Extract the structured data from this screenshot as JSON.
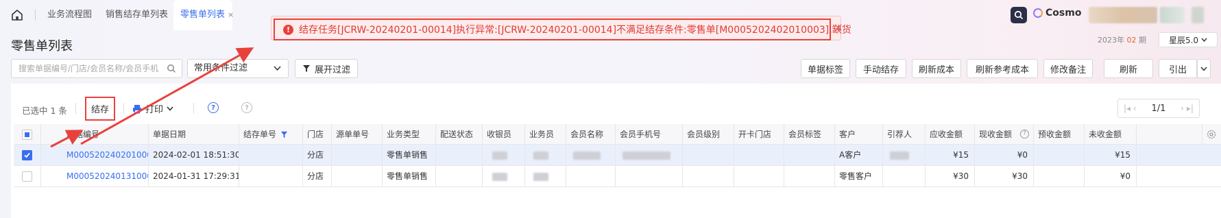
{
  "tabs": [
    {
      "label": "业务流程图"
    },
    {
      "label": "销售结存单列表"
    },
    {
      "label": "零售单列表",
      "close": "×"
    }
  ],
  "header": {
    "brand": "Cosmo"
  },
  "toast": {
    "message": "结存任务[JCRW-20240201-00014]执行异常:[JCRW-20240201-00014]不满足结存条件:零售单[M0005202402010003],缺货",
    "close": "×"
  },
  "page": {
    "title": "零售单列表",
    "year_label": "2023年",
    "period_value": "02",
    "period_label": "期",
    "version": "星辰5.0"
  },
  "filters": {
    "search_placeholder": "搜索单据编号/门店/会员名称/会员手机",
    "common_filter": "常用条件过滤",
    "expand_filter": "展开过滤"
  },
  "toolbar_right": {
    "tag": "单据标签",
    "manual_jiecun": "手动结存",
    "refresh_cost": "刷新成本",
    "refresh_ref_cost": "刷新参考成本",
    "edit_remark": "修改备注",
    "refresh": "刷新",
    "export": "引出"
  },
  "table_toolbar": {
    "selected": "已选中 1 条",
    "jiecun": "结存",
    "print": "打印",
    "pager": "1/1"
  },
  "columns": [
    "单据编号",
    "单据日期",
    "结存单号",
    "门店",
    "源单单号",
    "业务类型",
    "配送状态",
    "收银员",
    "业务员",
    "会员名称",
    "会员手机号",
    "会员级别",
    "开卡门店",
    "会员标签",
    "客户",
    "引荐人",
    "应收金额",
    "现收金额",
    "预收金额",
    "未收金额"
  ],
  "rows": [
    {
      "code": "M0005202402010003",
      "date": "2024-02-01 18:51:30",
      "store": "分店",
      "biz": "零售单销售",
      "customer": "A客户",
      "due": "¥15",
      "paid": "¥0",
      "unpaid": "¥15"
    },
    {
      "code": "M0005202401310003",
      "date": "2024-01-31 17:29:31",
      "store": "分店",
      "biz": "零售单销售",
      "customer": "零售客户",
      "due": "¥30",
      "paid": "¥30",
      "unpaid": "¥0"
    }
  ],
  "colors": {
    "accent": "#3a6df0",
    "error": "#e8413c"
  }
}
